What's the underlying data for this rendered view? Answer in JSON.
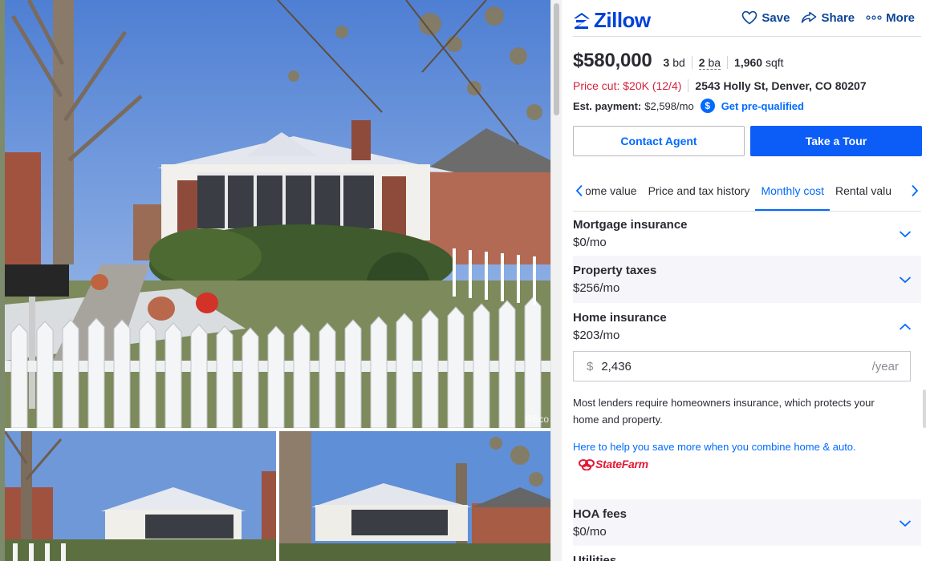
{
  "gallery": {
    "watermark": "REco",
    "photos": [
      {
        "name": "main-photo"
      },
      {
        "name": "photo-2"
      },
      {
        "name": "photo-3"
      }
    ]
  },
  "header": {
    "logo_text": "Zillow",
    "actions": {
      "save": "Save",
      "share": "Share",
      "more": "More"
    }
  },
  "listing": {
    "price": "$580,000",
    "beds_num": "3",
    "beds_unit": "bd",
    "baths_num": "2",
    "baths_unit": "ba",
    "sqft_num": "1,960",
    "sqft_unit": "sqft",
    "price_cut": "Price cut: $20K (12/4)",
    "address": "2543 Holly St, Denver, CO 80207",
    "est_payment_label": "Est. payment:",
    "est_payment_value": "$2,598/mo",
    "prequal_link": "Get pre-qualified",
    "dollar_symbol": "$"
  },
  "buttons": {
    "contact": "Contact Agent",
    "tour": "Take a Tour"
  },
  "tabs": [
    {
      "label": "ome value"
    },
    {
      "label": "Price and tax history"
    },
    {
      "label": "Monthly cost"
    },
    {
      "label": "Rental valu"
    }
  ],
  "costs": {
    "mortgage": {
      "title": "Mortgage insurance",
      "value": "$0/mo"
    },
    "taxes": {
      "title": "Property taxes",
      "value": "$256/mo"
    },
    "insurance": {
      "title": "Home insurance",
      "value": "$203/mo",
      "input_prefix": "$",
      "input_value": "2,436",
      "input_suffix": "/year",
      "note": "Most lenders require homeowners insurance, which protects your home and property.",
      "bundle_text": "Here to help you save more when you combine home & auto.",
      "partner": "StateFarm"
    },
    "hoa": {
      "title": "HOA fees",
      "value": "$0/mo"
    },
    "utilities": {
      "title": "Utilities"
    }
  },
  "colors": {
    "brand": "#006aff",
    "price_cut": "#d5223a",
    "statefarm": "#e31837"
  }
}
